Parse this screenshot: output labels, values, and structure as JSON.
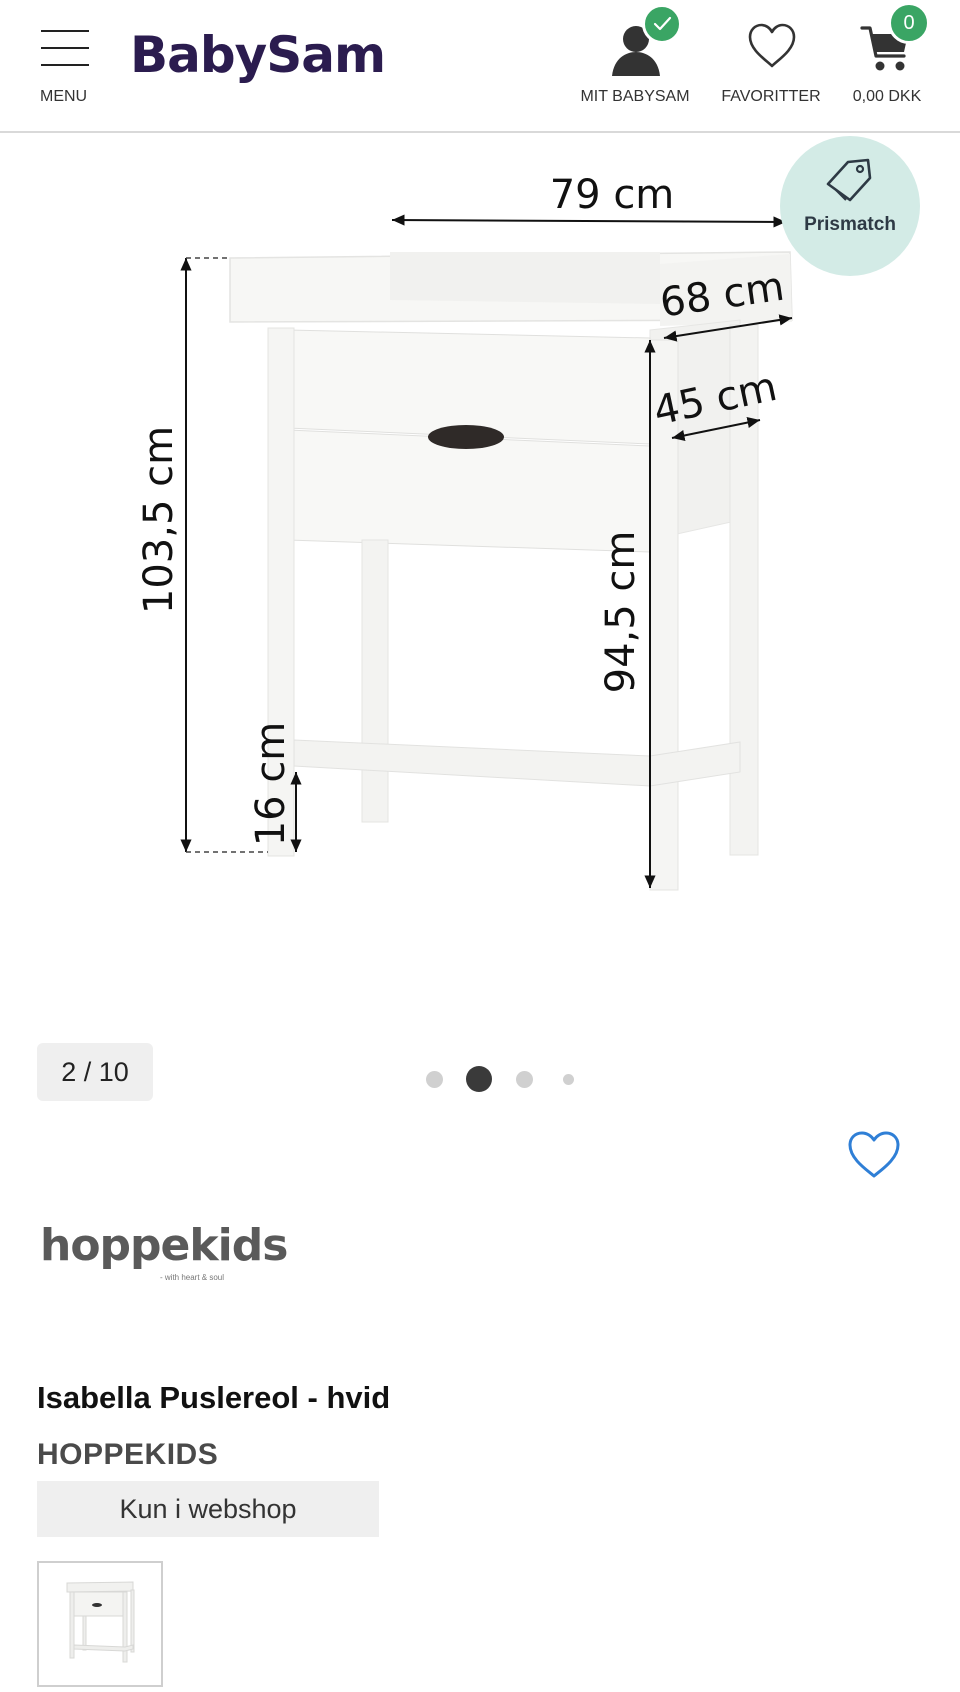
{
  "header": {
    "logo": "BabySam",
    "menu_label": "MENU",
    "account_label": "MIT BABYSAM",
    "favorites_label": "FAVORITTER",
    "cart_total": "0,00 DKK",
    "cart_count": "0"
  },
  "gallery": {
    "prismatch_label": "Prismatch",
    "counter": "2 / 10",
    "dots_total": 4,
    "active_dot": 1,
    "dimensions": {
      "width": "79 cm",
      "depth": "68 cm",
      "inner_depth": "45 cm",
      "total_height": "103,5 cm",
      "surface_height": "94,5 cm",
      "shelf_height": "16 cm"
    }
  },
  "product": {
    "brand_logo_word": "hoppekids",
    "brand_logo_tagline": "- with heart & soul",
    "title": "Isabella Puslereol - hvid",
    "brand": "HOPPEKIDS",
    "availability": "Kun i webshop"
  },
  "colors": {
    "brand_purple": "#2b1c4f",
    "badge_green": "#3aa564",
    "prismatch_bg": "#d3ebe6",
    "heart_blue": "#2f7fd6"
  },
  "icons": {
    "menu": "hamburger-icon",
    "account": "user-icon",
    "favorites": "heart-icon",
    "cart": "cart-icon",
    "prismatch": "price-tag-icon"
  }
}
